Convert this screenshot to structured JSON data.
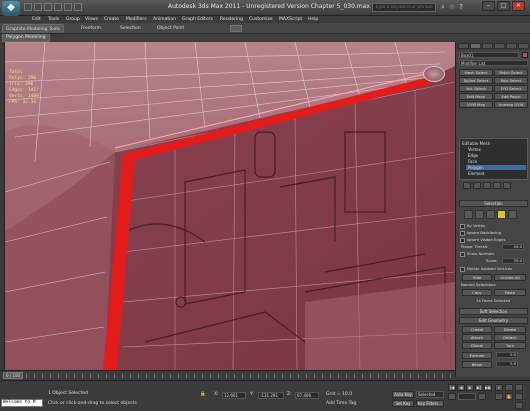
{
  "titlebar": {
    "title": "Autodesk 3ds Max  2011  -  Unregistered Version    Chapter 5_030.max",
    "search_placeholder": "Type a keyword or phrase",
    "minimize": "–",
    "maximize": "□",
    "close": "✕"
  },
  "menu": [
    "Edit",
    "Tools",
    "Group",
    "Views",
    "Create",
    "Modifiers",
    "Animation",
    "Graph Editors",
    "Rendering",
    "Customize",
    "MAXScript",
    "Help"
  ],
  "ribbon": {
    "tabs": [
      "Graphite Modeling Tools",
      "Freeform",
      "Selection",
      "Object Paint"
    ],
    "subtab": "Polygon Modeling"
  },
  "viewport": {
    "stats": [
      "Total",
      "Polys:  296",
      "Tris:   296",
      "Edges:  1417",
      "Verts:  1409",
      "FPS:  32.34"
    ]
  },
  "command_panel": {
    "object_name": "Box01",
    "modifier_list": "Modifier List",
    "modifier_buttons": [
      "Mesh Select",
      "Patch Select",
      "Spline Select",
      "Poly Select",
      "Vol. Select",
      "FFD Select",
      "Edit Mesh",
      "Edit Patch",
      "UVW Map",
      "Unwrap UVW"
    ],
    "stack": [
      "Editable Mesh",
      "Vertex",
      "Edge",
      "Face",
      "Polygon",
      "Element"
    ],
    "selection_rollout": "Selection",
    "by_vertex": "By Vertex",
    "ignore_backfacing": "Ignore Backfacing",
    "ignore_visible_edges": "Ignore Visible Edges",
    "planar_thresh": "Planar Thresh:",
    "planar_thresh_value": "45.0",
    "show_normals": "Show Normals",
    "scale": "Scale:",
    "scale_value": "20.0",
    "delete_isolated": "Delete Isolated Vertices",
    "hide": "Hide",
    "unhide_all": "Unhide All",
    "named_selections": "Named Selections:",
    "copy": "Copy",
    "paste": "Paste",
    "faces_selected": "14 Faces Selected",
    "soft_selection": "Soft Selection",
    "edit_geometry": "Edit Geometry",
    "create": "Create",
    "delete": "Delete",
    "attach": "Attach",
    "detach": "Detach",
    "divide": "Divide",
    "turn": "Turn",
    "extrude": "Extrude",
    "extrude_value": "0.0",
    "bevel": "Bevel",
    "bevel_value": "0.0"
  },
  "timeline": {
    "slider": "0 / 100"
  },
  "statusbar": {
    "selection": "1 Object Selected",
    "prompt": "Click or click-and-drag to select objects",
    "x_label": "X:",
    "x_value": "12.661",
    "y_label": "Y:",
    "y_value": "-131.291",
    "z_label": "Z:",
    "z_value": "67.406",
    "grid": "Grid = 10.0",
    "add_time_tag": "Add Time Tag",
    "auto_key": "Auto Key",
    "selected": "Selected",
    "set_key": "Set Key",
    "key_filters": "Key Filters...",
    "maxscript": "Welcome to M"
  },
  "colors": {
    "viewport_bg": "#7d3a48",
    "selected_edge": "#e31b1b",
    "accent": "#3f6aa0"
  }
}
